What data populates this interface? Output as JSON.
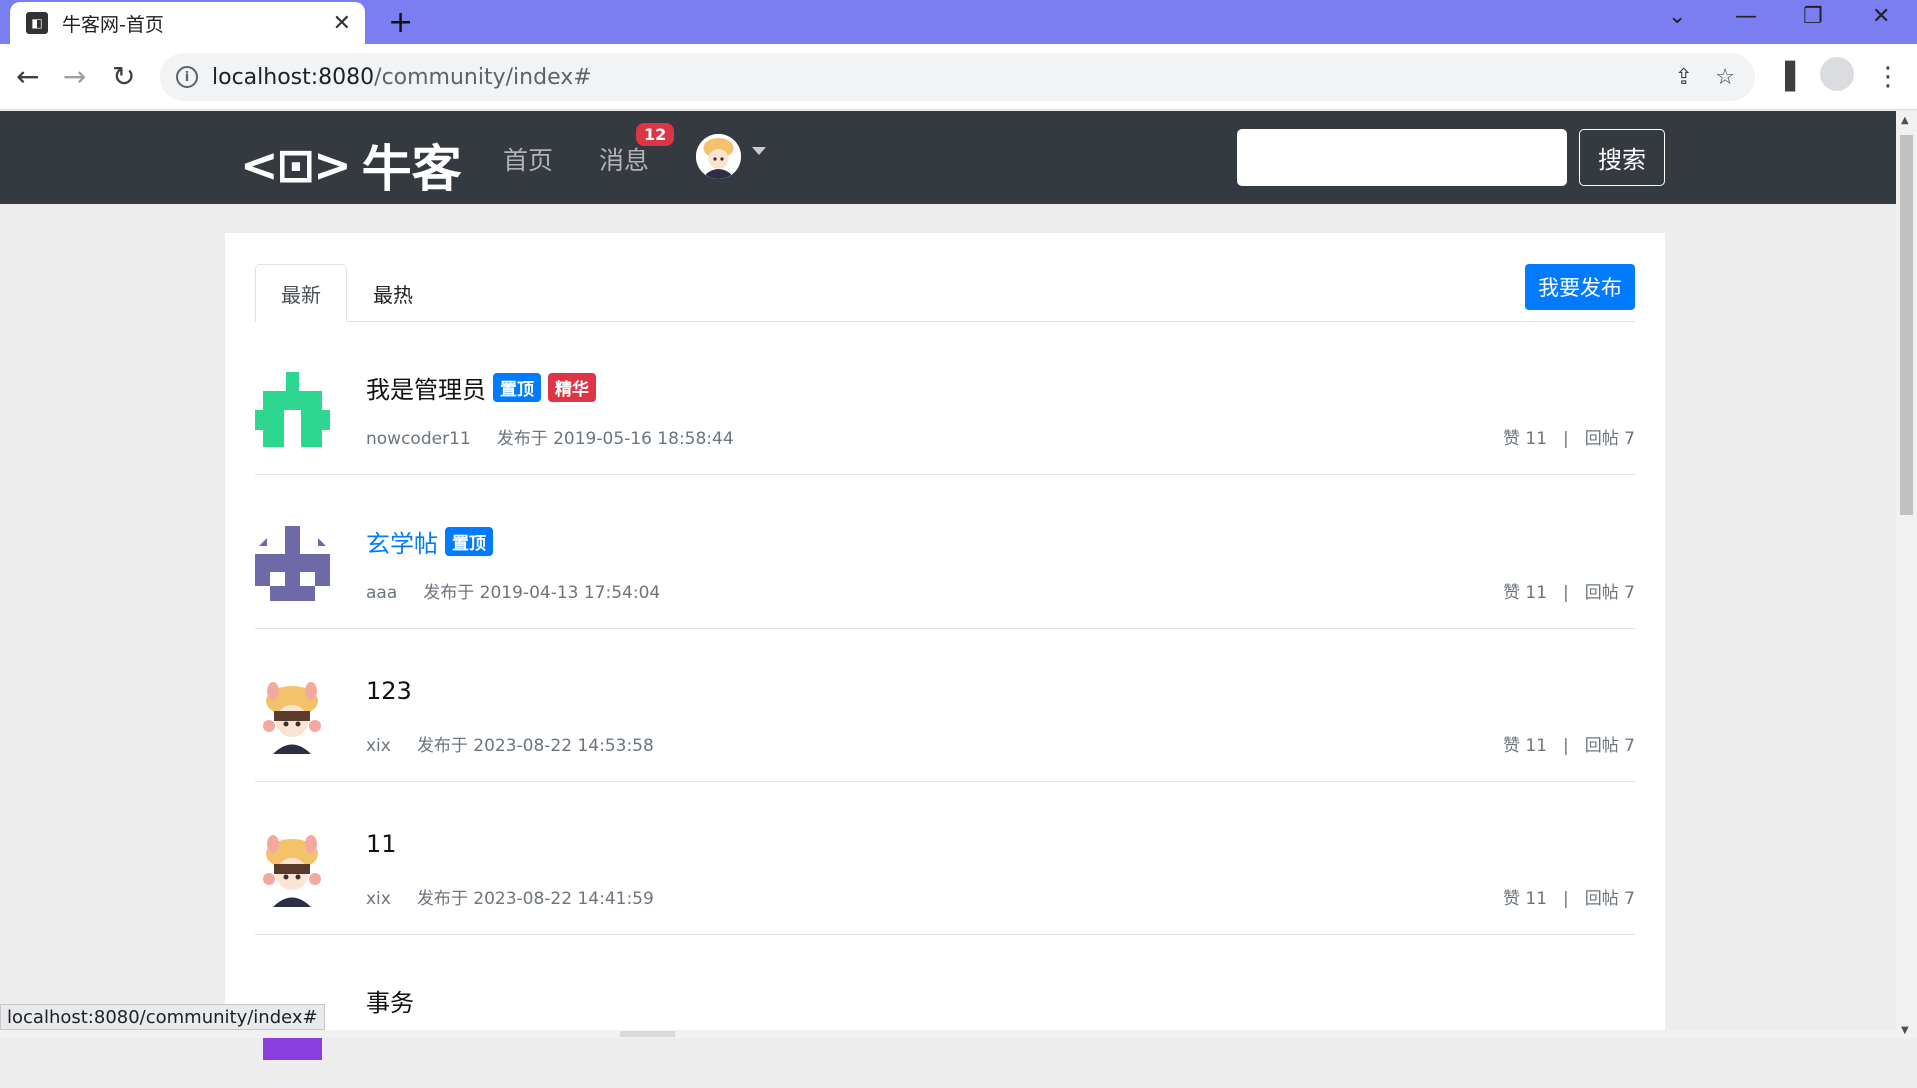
{
  "browser": {
    "tab_title": "牛客网-首页",
    "tab_favicon": "nowcoder-favicon",
    "url_host": "localhost:8080",
    "url_path": "/community/index#",
    "status_url": "localhost:8080/community/index#"
  },
  "header": {
    "logo_text": "牛客",
    "nav_home": "首页",
    "nav_messages": "消息",
    "message_count": "12",
    "search_placeholder": "",
    "search_button": "搜索"
  },
  "content": {
    "tab_latest": "最新",
    "tab_hot": "最热",
    "publish_button": "我要发布",
    "posts": [
      {
        "title": "我是管理员",
        "tags": [
          "置顶",
          "精华"
        ],
        "author": "nowcoder11",
        "published": "发布于 2019-05-16 18:58:44",
        "likes": "赞 11",
        "replies": "回帖 7",
        "avatar": "green-identicon",
        "title_color": "#111111"
      },
      {
        "title": "玄学帖",
        "tags": [
          "置顶"
        ],
        "author": "aaa",
        "published": "发布于 2019-04-13 17:54:04",
        "likes": "赞 11",
        "replies": "回帖 7",
        "avatar": "purple-identicon",
        "title_color": "#007bff"
      },
      {
        "title": "123",
        "tags": [],
        "author": "xix",
        "published": "发布于 2023-08-22 14:53:58",
        "likes": "赞 11",
        "replies": "回帖 7",
        "avatar": "cartoon-girl-avatar",
        "title_color": "#111111"
      },
      {
        "title": "11",
        "tags": [],
        "author": "xix",
        "published": "发布于 2023-08-22 14:41:59",
        "likes": "赞 11",
        "replies": "回帖 7",
        "avatar": "cartoon-girl-avatar",
        "title_color": "#111111"
      },
      {
        "title": "事务",
        "tags": [],
        "author": "",
        "published": "",
        "likes": "",
        "replies": "",
        "avatar": "purple-identicon-partial",
        "title_color": "#111111"
      }
    ],
    "separator": "|"
  },
  "colors": {
    "tabbar": "#7a7ef0",
    "header_bg": "#343a40",
    "primary": "#007bff",
    "danger": "#dc3545",
    "green_identicon": "#2ed78f",
    "purple_identicon": "#6e6aa8"
  }
}
